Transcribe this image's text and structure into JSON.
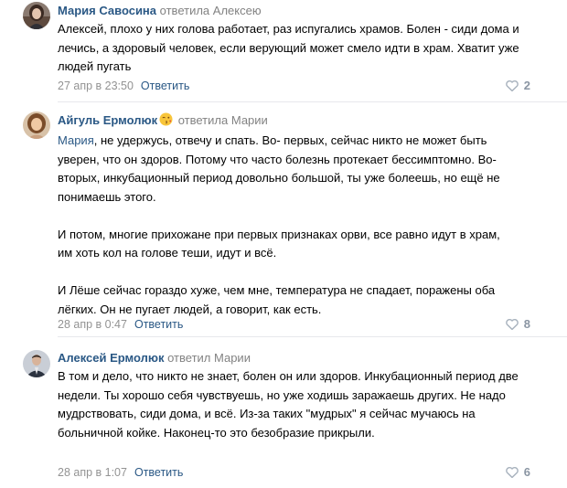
{
  "comments": [
    {
      "author": "Мария Савосина",
      "replied": "ответила",
      "reply_to": "Алексею",
      "mention": "",
      "text": "Алексей, плохо у них голова работает, раз испугались храмов. Болен - сиди дома и лечись, а здоровый человек, если верующий может смело идти в храм. Хватит уже людей пугать",
      "date": "27 апр в 23:50",
      "reply_label": "Ответить",
      "likes": "2",
      "avatar_icon": "woman-portrait-icon"
    },
    {
      "author": "Айгуль Ермолюк",
      "author_emoji": "😘",
      "replied": "ответила",
      "reply_to": "Марии",
      "mention": "Мария",
      "text_after_mention": ", не удержусь, отвечу и спать. Во- первых, сейчас никто не может быть уверен, что он здоров. Потому что часто болезнь протекает бессимптомно. Во- вторых, инкубационный период довольно большой, ты уже болеешь, но ещё не понимаешь этого.\n\nИ потом, многие прихожане при первых признаках орви, все равно идут в храм, им хоть кол на голове теши, идут и всё.\n\nИ Лёше сейчас гораздо хуже, чем мне, температура не спадает, поражены оба лёгких. Он не пугает людей, а говорит, как есть.",
      "date": "28 апр в 0:47",
      "reply_label": "Ответить",
      "likes": "8",
      "avatar_icon": "woman-portrait-icon"
    },
    {
      "author": "Алексей Ермолюк",
      "replied": "ответил",
      "reply_to": "Марии",
      "mention": "",
      "text": "В том и дело, что никто не знает, болен он или здоров. Инкубационный период две недели. Ты хорошо себя чувствуешь, но уже ходишь заражаешь других. Не надо мудрствовать, сиди дома, и всё. Из-за таких \"мудрых\" я сейчас мучаюсь на больничной койке. Наконец-то это безобразие прикрыли.",
      "date": "28 апр в 1:07",
      "reply_label": "Ответить",
      "likes": "6",
      "avatar_icon": "man-portrait-icon"
    }
  ],
  "colors": {
    "link": "#2a5885",
    "muted": "#828282",
    "likes": "#8a95a3",
    "divider": "#e7e8ec"
  }
}
